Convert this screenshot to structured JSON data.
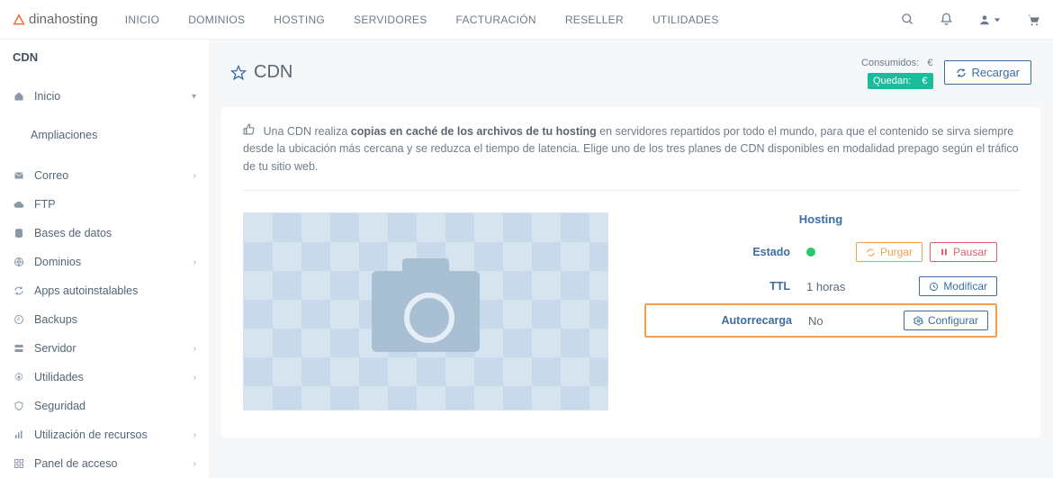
{
  "brand": "dinahosting",
  "topnav": [
    "INICIO",
    "DOMINIOS",
    "HOSTING",
    "SERVIDORES",
    "FACTURACIÓN",
    "RESELLER",
    "UTILIDADES"
  ],
  "breadcrumb": "CDN",
  "sidebar": {
    "items": [
      {
        "icon": "home",
        "label": "Inicio",
        "chev": "down"
      },
      {
        "sub": true,
        "label": "Ampliaciones"
      },
      {
        "icon": "mail",
        "label": "Correo",
        "chev": "right"
      },
      {
        "icon": "cloud",
        "label": "FTP"
      },
      {
        "icon": "db",
        "label": "Bases de datos"
      },
      {
        "icon": "globe",
        "label": "Dominios",
        "chev": "right"
      },
      {
        "icon": "refresh",
        "label": "Apps autoinstalables"
      },
      {
        "icon": "backup",
        "label": "Backups"
      },
      {
        "icon": "server",
        "label": "Servidor",
        "chev": "right"
      },
      {
        "icon": "gear",
        "label": "Utilidades",
        "chev": "right"
      },
      {
        "icon": "shield",
        "label": "Seguridad"
      },
      {
        "icon": "chart",
        "label": "Utilización de recursos",
        "chev": "right"
      },
      {
        "icon": "panel",
        "label": "Panel de acceso",
        "chev": "right"
      }
    ]
  },
  "page": {
    "title": "CDN",
    "consumed_label": "Consumidos:",
    "consumed_currency": "€",
    "quedan_label": "Quedan:",
    "quedan_value": "€",
    "reload": "Recargar",
    "info_pre": "Una CDN realiza ",
    "info_bold": "copias en caché de los archivos de tu hosting",
    "info_post": " en servidores repartidos por todo el mundo, para que el contenido se sirva siempre desde la ubicación más cercana y se reduzca el tiempo de latencia. Elige uno de los tres planes de CDN disponibles en modalidad prepago según el tráfico de tu sitio web."
  },
  "details": {
    "hosting_label": "Hosting",
    "estado_label": "Estado",
    "ttl_label": "TTL",
    "ttl_value": "1 horas",
    "autorrecarga_label": "Autorrecarga",
    "autorrecarga_value": "No",
    "purgar": "Purgar",
    "pausar": "Pausar",
    "modificar": "Modificar",
    "configurar": "Configurar"
  }
}
